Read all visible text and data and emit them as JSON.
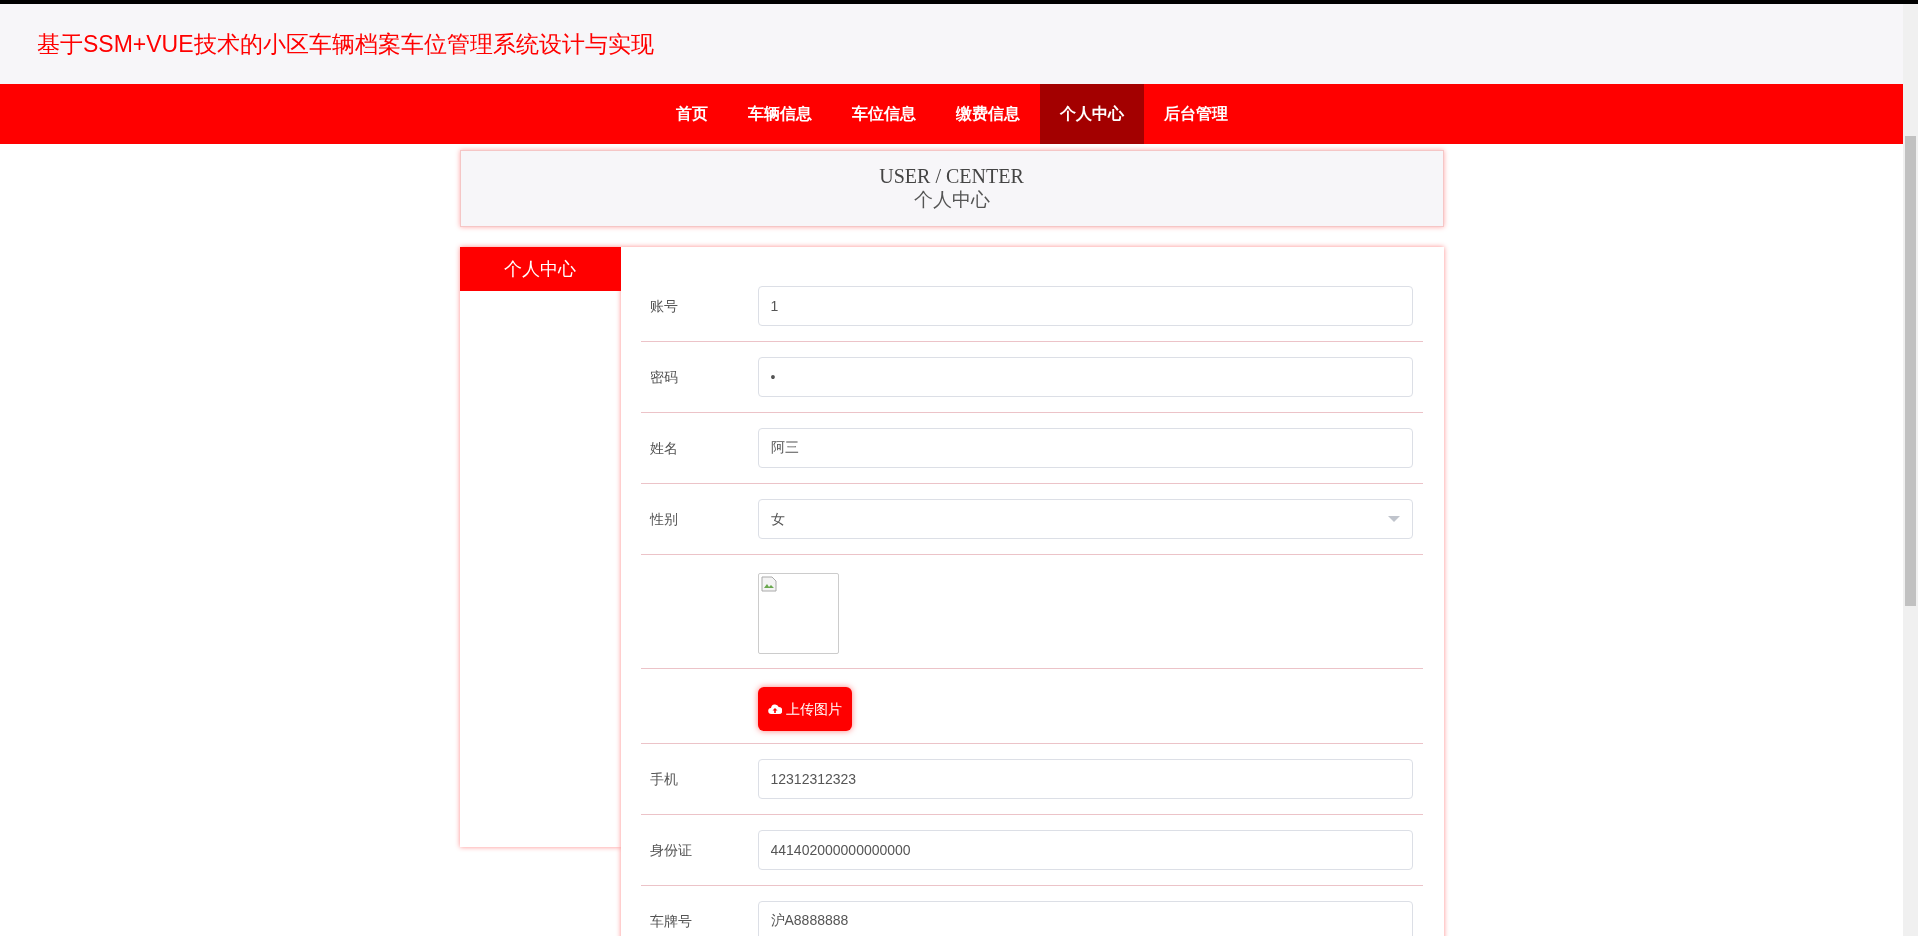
{
  "header": {
    "title": "基于SSM+VUE技术的小区车辆档案车位管理系统设计与实现"
  },
  "nav": [
    {
      "label": "首页",
      "selected": false
    },
    {
      "label": "车辆信息",
      "selected": false
    },
    {
      "label": "车位信息",
      "selected": false
    },
    {
      "label": "缴费信息",
      "selected": false
    },
    {
      "label": "个人中心",
      "selected": true
    },
    {
      "label": "后台管理",
      "selected": false
    }
  ],
  "page_heading": {
    "english": "USER / CENTER",
    "title": "个人中心"
  },
  "sidebar": {
    "title": "个人中心"
  },
  "form": [
    {
      "kind": "input",
      "label": "账号",
      "value": "1"
    },
    {
      "kind": "input",
      "label": "密码",
      "value": "•"
    },
    {
      "kind": "input",
      "label": "姓名",
      "value": "阿三"
    },
    {
      "kind": "select",
      "label": "性别",
      "value": "女"
    },
    {
      "kind": "image"
    },
    {
      "kind": "upload",
      "button": "上传图片"
    },
    {
      "kind": "input",
      "label": "手机",
      "value": "12312312323"
    },
    {
      "kind": "input",
      "label": "身份证",
      "value": "441402000000000000"
    },
    {
      "kind": "input",
      "label": "车牌号",
      "value": "沪A8888888"
    }
  ]
}
